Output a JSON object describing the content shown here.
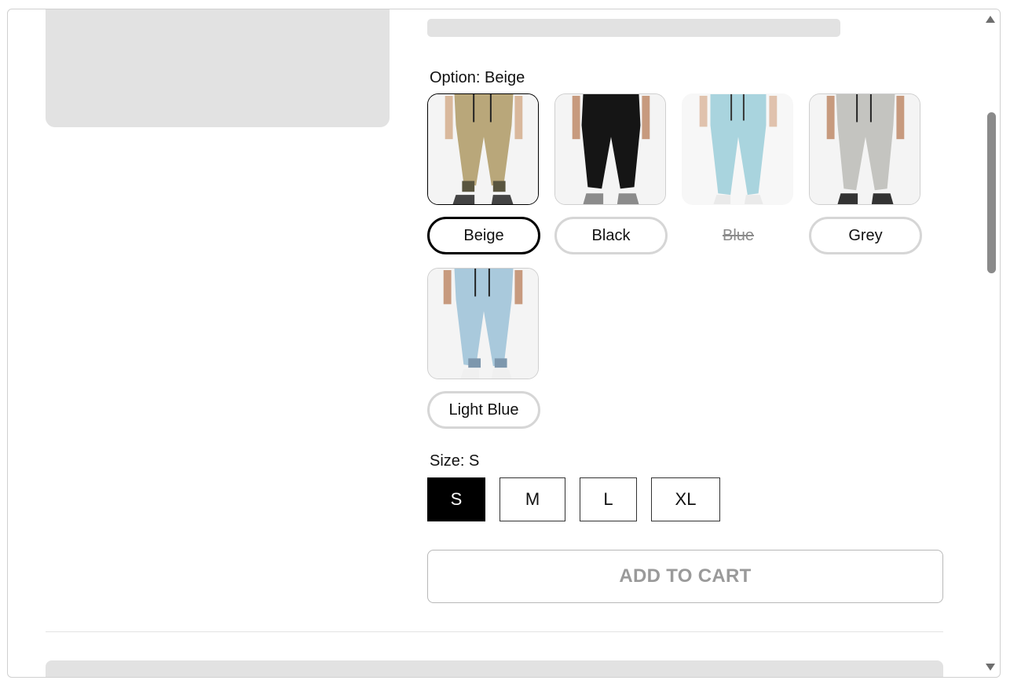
{
  "option": {
    "label": "Option: Beige",
    "selected": "Beige",
    "swatches": [
      {
        "name": "Beige",
        "color": "#b9a77a",
        "state": "selected"
      },
      {
        "name": "Black",
        "color": "#151515",
        "state": "normal"
      },
      {
        "name": "Blue",
        "color": "#a9d4de",
        "state": "unavailable"
      },
      {
        "name": "Grey",
        "color": "#c4c4c0",
        "state": "normal"
      },
      {
        "name": "Light Blue",
        "color": "#a9c9dc",
        "state": "normal"
      }
    ]
  },
  "size": {
    "label": "Size: S",
    "options": [
      "S",
      "M",
      "L",
      "XL"
    ],
    "selected": "S"
  },
  "cart": {
    "button_label": "ADD TO CART"
  }
}
